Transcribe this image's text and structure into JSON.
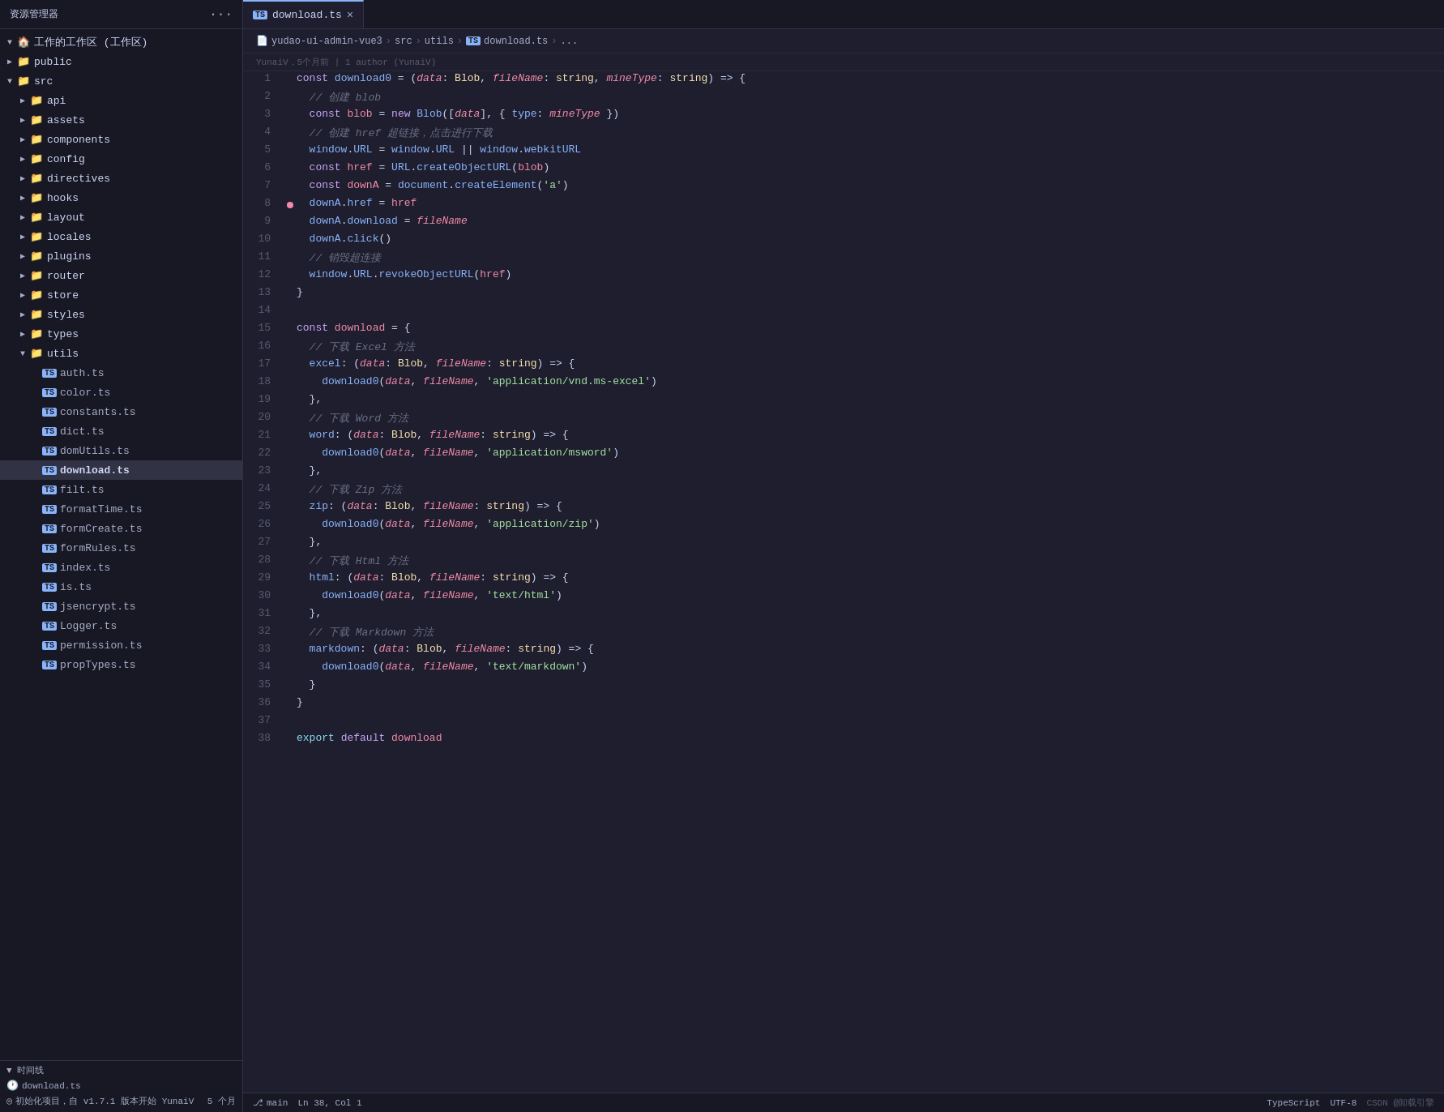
{
  "sidebar": {
    "title": "资源管理器",
    "workspace": "工作的工作区 (工作区)",
    "items": [
      {
        "id": "public",
        "label": "public",
        "type": "folder",
        "depth": 1,
        "expanded": false,
        "arrow": "▶"
      },
      {
        "id": "src",
        "label": "src",
        "type": "folder-src",
        "depth": 1,
        "expanded": true,
        "arrow": "▼"
      },
      {
        "id": "api",
        "label": "api",
        "type": "folder",
        "depth": 2,
        "expanded": false,
        "arrow": "▶"
      },
      {
        "id": "assets",
        "label": "assets",
        "type": "folder",
        "depth": 2,
        "expanded": false,
        "arrow": "▶"
      },
      {
        "id": "components",
        "label": "components",
        "type": "folder",
        "depth": 2,
        "expanded": false,
        "arrow": "▶"
      },
      {
        "id": "config",
        "label": "config",
        "type": "folder",
        "depth": 2,
        "expanded": false,
        "arrow": "▶"
      },
      {
        "id": "directives",
        "label": "directives",
        "type": "folder",
        "depth": 2,
        "expanded": false,
        "arrow": "▶"
      },
      {
        "id": "hooks",
        "label": "hooks",
        "type": "folder",
        "depth": 2,
        "expanded": false,
        "arrow": "▶"
      },
      {
        "id": "layout",
        "label": "layout",
        "type": "folder",
        "depth": 2,
        "expanded": false,
        "arrow": "▶"
      },
      {
        "id": "locales",
        "label": "locales",
        "type": "folder",
        "depth": 2,
        "expanded": false,
        "arrow": "▶"
      },
      {
        "id": "plugins",
        "label": "plugins",
        "type": "folder",
        "depth": 2,
        "expanded": false,
        "arrow": "▶"
      },
      {
        "id": "router",
        "label": "router",
        "type": "folder",
        "depth": 2,
        "expanded": false,
        "arrow": "▶"
      },
      {
        "id": "store",
        "label": "store",
        "type": "folder",
        "depth": 2,
        "expanded": false,
        "arrow": "▶"
      },
      {
        "id": "styles",
        "label": "styles",
        "type": "folder",
        "depth": 2,
        "expanded": false,
        "arrow": "▶"
      },
      {
        "id": "types",
        "label": "types",
        "type": "folder",
        "depth": 2,
        "expanded": false,
        "arrow": "▶"
      },
      {
        "id": "utils",
        "label": "utils",
        "type": "folder",
        "depth": 2,
        "expanded": true,
        "arrow": "▼"
      },
      {
        "id": "auth.ts",
        "label": "auth.ts",
        "type": "ts",
        "depth": 3
      },
      {
        "id": "color.ts",
        "label": "color.ts",
        "type": "ts",
        "depth": 3
      },
      {
        "id": "constants.ts",
        "label": "constants.ts",
        "type": "ts",
        "depth": 3
      },
      {
        "id": "dict.ts",
        "label": "dict.ts",
        "type": "ts",
        "depth": 3
      },
      {
        "id": "domUtils.ts",
        "label": "domUtils.ts",
        "type": "ts",
        "depth": 3
      },
      {
        "id": "download.ts",
        "label": "download.ts",
        "type": "ts",
        "depth": 3,
        "active": true
      },
      {
        "id": "filt.ts",
        "label": "filt.ts",
        "type": "ts",
        "depth": 3
      },
      {
        "id": "formatTime.ts",
        "label": "formatTime.ts",
        "type": "ts",
        "depth": 3
      },
      {
        "id": "formCreate.ts",
        "label": "formCreate.ts",
        "type": "ts",
        "depth": 3
      },
      {
        "id": "formRules.ts",
        "label": "formRules.ts",
        "type": "ts",
        "depth": 3
      },
      {
        "id": "index.ts",
        "label": "index.ts",
        "type": "ts",
        "depth": 3
      },
      {
        "id": "is.ts",
        "label": "is.ts",
        "type": "ts",
        "depth": 3
      },
      {
        "id": "jsencrypt.ts",
        "label": "jsencrypt.ts",
        "type": "ts",
        "depth": 3
      },
      {
        "id": "Logger.ts",
        "label": "Logger.ts",
        "type": "ts",
        "depth": 3
      },
      {
        "id": "permission.ts",
        "label": "permission.ts",
        "type": "ts",
        "depth": 3
      },
      {
        "id": "propTypes.ts",
        "label": "propTypes.ts",
        "type": "ts",
        "depth": 3
      }
    ],
    "timeline": {
      "title": "时间线",
      "item": "download.ts",
      "commit": "初始化项目，自 v1.7.1 版本开始  YunaiV",
      "time": "5 个月"
    }
  },
  "tab": {
    "ts_badge": "TS",
    "filename": "download.ts",
    "close": "×"
  },
  "breadcrumb": {
    "parts": [
      "yudao-ui-admin-vue3",
      "src",
      "utils",
      "download.ts",
      "..."
    ],
    "ts_badge": "TS"
  },
  "git_blame": {
    "text": "YunaiV，5个月前 | 1 author (YunaiV)"
  },
  "code_lines": [
    {
      "num": 1,
      "content": "const download0 = (data: Blob, fileName: string, mineType: string) => {"
    },
    {
      "num": 2,
      "content": "  // 创建 blob"
    },
    {
      "num": 3,
      "content": "  const blob = new Blob([data], { type: mineType })"
    },
    {
      "num": 4,
      "content": "  // 创建 href 超链接，点击进行下载"
    },
    {
      "num": 5,
      "content": "  window.URL = window.URL || window.webkitURL"
    },
    {
      "num": 6,
      "content": "  const href = URL.createObjectURL(blob)"
    },
    {
      "num": 7,
      "content": "  const downA = document.createElement('a')"
    },
    {
      "num": 8,
      "content": "  downA.href = href",
      "has_dot": true
    },
    {
      "num": 9,
      "content": "  downA.download = fileName"
    },
    {
      "num": 10,
      "content": "  downA.click()"
    },
    {
      "num": 11,
      "content": "  // 销毁超连接"
    },
    {
      "num": 12,
      "content": "  window.URL.revokeObjectURL(href)"
    },
    {
      "num": 13,
      "content": "}"
    },
    {
      "num": 14,
      "content": ""
    },
    {
      "num": 15,
      "content": "const download = {"
    },
    {
      "num": 16,
      "content": "  // 下载 Excel 方法"
    },
    {
      "num": 17,
      "content": "  excel: (data: Blob, fileName: string) => {"
    },
    {
      "num": 18,
      "content": "    download0(data, fileName, 'application/vnd.ms-excel')"
    },
    {
      "num": 19,
      "content": "  },"
    },
    {
      "num": 20,
      "content": "  // 下载 Word 方法"
    },
    {
      "num": 21,
      "content": "  word: (data: Blob, fileName: string) => {"
    },
    {
      "num": 22,
      "content": "    download0(data, fileName, 'application/msword')"
    },
    {
      "num": 23,
      "content": "  },"
    },
    {
      "num": 24,
      "content": "  // 下载 Zip 方法"
    },
    {
      "num": 25,
      "content": "  zip: (data: Blob, fileName: string) => {"
    },
    {
      "num": 26,
      "content": "    download0(data, fileName, 'application/zip')"
    },
    {
      "num": 27,
      "content": "  },"
    },
    {
      "num": 28,
      "content": "  // 下载 Html 方法"
    },
    {
      "num": 29,
      "content": "  html: (data: Blob, fileName: string) => {"
    },
    {
      "num": 30,
      "content": "    download0(data, fileName, 'text/html')"
    },
    {
      "num": 31,
      "content": "  },"
    },
    {
      "num": 32,
      "content": "  // 下载 Markdown 方法"
    },
    {
      "num": 33,
      "content": "  markdown: (data: Blob, fileName: string) => {"
    },
    {
      "num": 34,
      "content": "    download0(data, fileName, 'text/markdown')"
    },
    {
      "num": 35,
      "content": "  }"
    },
    {
      "num": 36,
      "content": "}"
    },
    {
      "num": 37,
      "content": ""
    },
    {
      "num": 38,
      "content": "export default download"
    }
  ],
  "status_bar": {
    "branch": "⎇",
    "branch_name": "main",
    "file_info": "UTF-8",
    "language": "TypeScript",
    "watermark": "CSDN @卸载引擎",
    "position": "Ln 38, Col 1"
  }
}
